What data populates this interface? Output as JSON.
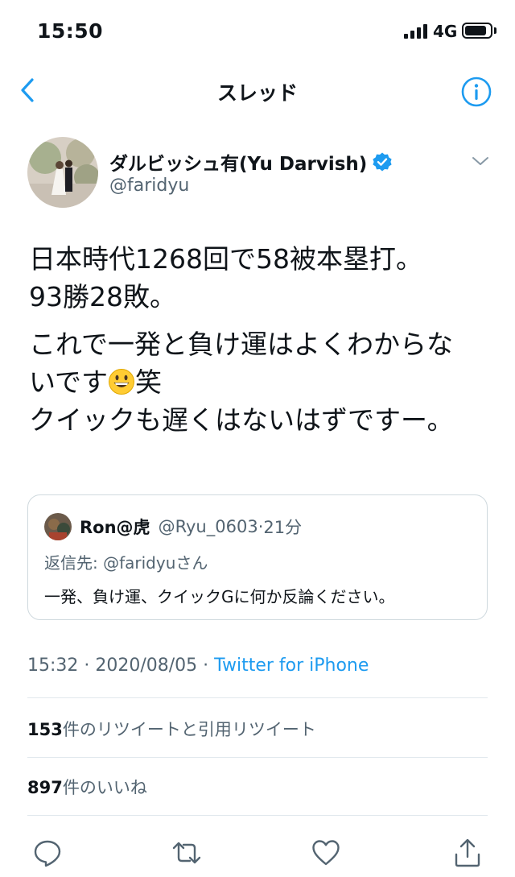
{
  "status_bar": {
    "time": "15:50",
    "network": "4G",
    "battery_level": 0.85
  },
  "nav": {
    "title": "スレッド",
    "back_icon": "chevron-left-icon",
    "info_icon": "info-icon"
  },
  "tweet": {
    "display_name": "ダルビッシュ有(Yu Darvish)",
    "handle": "@faridyu",
    "verified_icon": "verified-badge-icon",
    "line1": "日本時代1268回で58被本塁打。",
    "line2": "93勝28敗。",
    "line3": "これで一発と負け運はよくわからな",
    "line4a": "いです",
    "line4b": "笑",
    "line5": "クイックも遅くはないはずですー。",
    "emoji_icon": "grinning-face-emoji",
    "timestamp": "15:32 · 2020/08/05 · ",
    "source": "Twitter for iPhone"
  },
  "quote": {
    "name": "Ron@虎",
    "handle": "@Ryu_0603",
    "separator": "·",
    "time": "21分",
    "reply_to": "返信先: @faridyuさん",
    "text": "一発、負け運、クイックGに何か反論ください。"
  },
  "stats": {
    "retweets_count": "153",
    "retweets_label": "件のリツイートと引用リツイート",
    "likes_count": "897",
    "likes_label": "件のいいね"
  },
  "actions": [
    "reply-icon",
    "retweet-icon",
    "like-icon",
    "share-icon"
  ],
  "colors": {
    "accent": "#1d9bf0",
    "secondary_text": "#536471",
    "divider": "#e1e8ed"
  }
}
